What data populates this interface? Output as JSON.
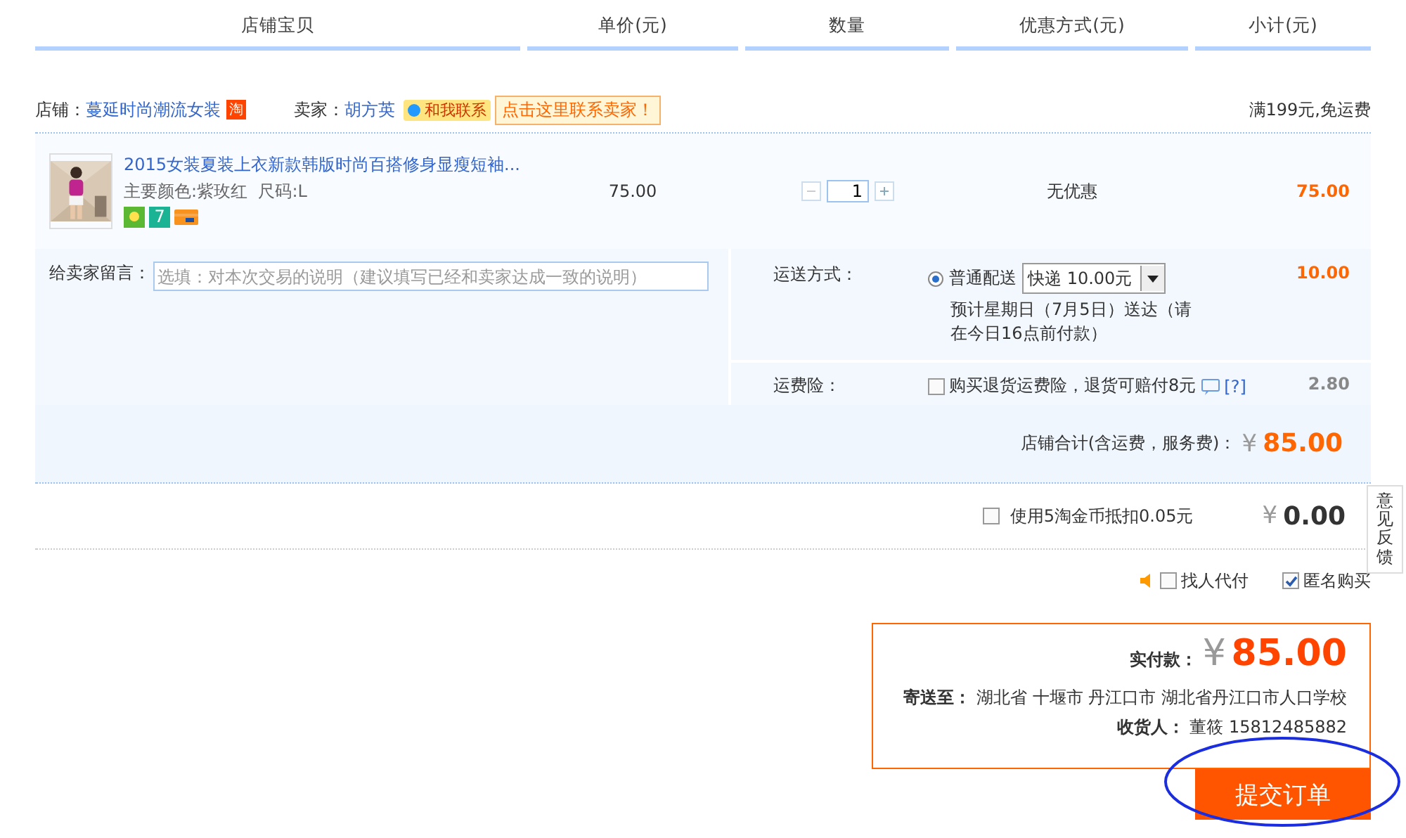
{
  "columns": [
    "店铺宝贝",
    "单价(元)",
    "数量",
    "优惠方式(元)",
    "小计(元)"
  ],
  "shop": {
    "label": "店铺：",
    "name": "蔓延时尚潮流女装",
    "badge": "淘",
    "seller_label": "卖家：",
    "seller": "胡方英",
    "contact": "和我联系",
    "contact_tip": "点击这里联系卖家！",
    "shipping_note": "满199元,免运费"
  },
  "item": {
    "kind": "picture",
    "title": "2015女装夏装上衣新款韩版时尚百搭修身显瘦短袖...",
    "attributes": "主要颜色:紫玫红  尺码:L",
    "service_badge": "7",
    "price": "75.00",
    "quantity": "1",
    "discount": "无优惠",
    "subtotal": "75.00"
  },
  "message": {
    "label": "给卖家留言：",
    "placeholder": "选填：对本次交易的说明（建议填写已经和卖家达成一致的说明）"
  },
  "shipping": {
    "label": "运送方式：",
    "option": "普通配送",
    "selected": true,
    "method": "快递 10.00元",
    "estimate": "预计星期日（7月5日）送达（请在今日16点前付款）",
    "fee": "10.00"
  },
  "insurance": {
    "label": "运费险：",
    "text": "购买退货运费险，退货可赔付8元",
    "help": "[?]",
    "checked": false,
    "fee": "2.80"
  },
  "store_total": {
    "label": "店铺合计(含运费，服务费)：",
    "currency": "¥",
    "amount": "85.00"
  },
  "coins": {
    "text": "使用5淘金币抵扣0.05元",
    "checked": false,
    "currency": "¥",
    "amount": "0.00"
  },
  "options": [
    {
      "label": "找人代付",
      "checked": false
    },
    {
      "label": "匿名购买",
      "checked": true
    }
  ],
  "payment": {
    "label": "实付款：",
    "currency": "¥",
    "amount": "85.00",
    "address_label": "寄送至：",
    "address": "湖北省 十堰市 丹江口市 湖北省丹江口市人口学校",
    "receiver_label": "收货人：",
    "receiver": "董筱 15812485882"
  },
  "submit": "提交订单",
  "feedback": "意见反馈"
}
